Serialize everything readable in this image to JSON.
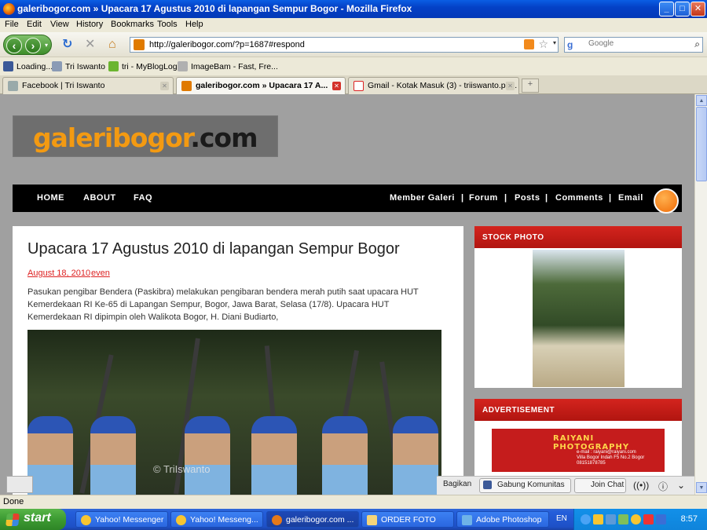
{
  "window": {
    "title": "galeribogor.com » Upacara 17 Agustus 2010 di lapangan Sempur Bogor - Mozilla Firefox",
    "controls": [
      "_",
      "□",
      "✕"
    ]
  },
  "menu": [
    "File",
    "Edit",
    "View",
    "History",
    "Bookmarks",
    "Tools",
    "Help"
  ],
  "nav": {
    "url": "http://galeribogor.com/?p=1687#respond",
    "search_placeholder": "Google"
  },
  "bookmarks": [
    "Loading...",
    "Tri Iswanto",
    "tri - MyBlogLog",
    "ImageBam - Fast, Fre..."
  ],
  "tabs": [
    {
      "label": "Facebook | Tri Iswanto",
      "active": false
    },
    {
      "label": "galeribogor.com » Upacara 17 A...",
      "active": true
    },
    {
      "label": "Gmail - Kotak Masuk (3) - triiswanto.ph...",
      "active": false
    }
  ],
  "site": {
    "logo_main": "galeribogor",
    "logo_tld": ".com",
    "nav_left": [
      "HOME",
      "ABOUT",
      "FAQ"
    ],
    "nav_right": [
      "Member Galeri",
      "|",
      "Forum",
      "|",
      "Posts",
      "|",
      "Comments",
      "|",
      "Email"
    ]
  },
  "post": {
    "title": "Upacara 17 Agustus 2010 di lapangan Sempur Bogor",
    "date": "August 18, 2010",
    "category": "even",
    "body": "Pasukan pengibar Bendera (Paskibra) melakukan pengibaran bendera merah putih saat upacara HUT Kemerdekaan RI Ke-65 di Lapangan Sempur, Bogor, Jawa Barat, Selasa (17/8). Upacara HUT Kemerdekaan RI dipimpin oleh Walikota Bogor, H. Diani Budiarto,",
    "watermark": "© TriIswanto"
  },
  "sidebar": {
    "stock_title": "STOCK PHOTO",
    "ad_title": "ADVERTISEMENT",
    "ad_name": "RAIYANI PHOTOGRAPHY",
    "ad_lines": [
      "e-mail : raiyani@raiyani.com",
      "Villa Bogor Indah F5 No.2 Bogor",
      "08151878785"
    ]
  },
  "social_bar": {
    "share": "Bagikan",
    "join": "Gabung Komunitas",
    "chat": "Join Chat"
  },
  "status": "Done",
  "taskbar": {
    "start": "start",
    "tasks": [
      {
        "label": "Yahoo! Messenger",
        "active": false
      },
      {
        "label": "Yahoo! Messeng...",
        "active": false
      },
      {
        "label": "galeribogor.com ...",
        "active": true
      },
      {
        "label": "ORDER FOTO",
        "active": false
      },
      {
        "label": "Adobe Photoshop",
        "active": false
      }
    ],
    "lang": "EN",
    "clock": "8:57"
  },
  "colors": {
    "accent_red": "#c41a15",
    "logo_orange": "#f39a12",
    "xp_blue": "#245edb"
  }
}
